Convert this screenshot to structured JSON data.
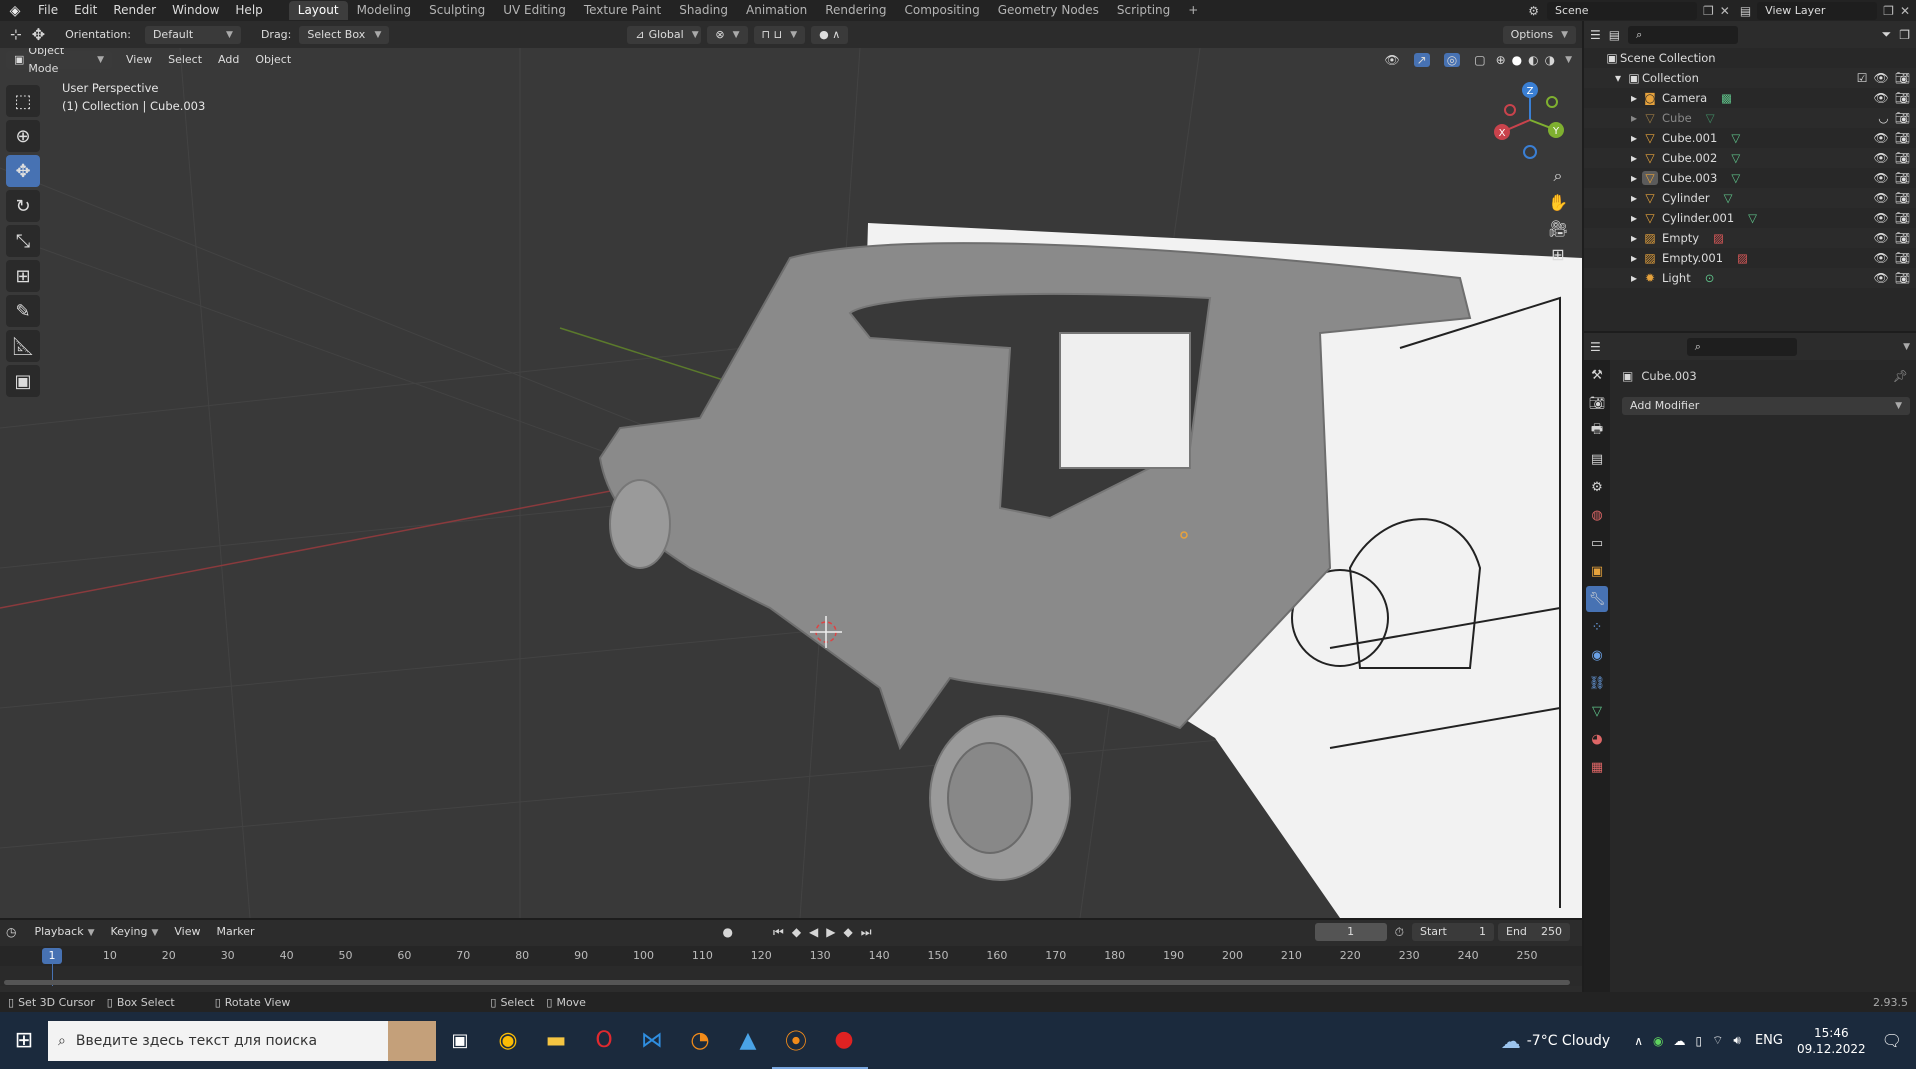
{
  "topbar": {
    "menus": [
      "File",
      "Edit",
      "Render",
      "Window",
      "Help"
    ],
    "workspaces": [
      "Layout",
      "Modeling",
      "Sculpting",
      "UV Editing",
      "Texture Paint",
      "Shading",
      "Animation",
      "Rendering",
      "Compositing",
      "Geometry Nodes",
      "Scripting"
    ],
    "active_workspace": "Layout",
    "add_tab": "+",
    "scene_label": "Scene",
    "view_layer_label": "View Layer"
  },
  "header1": {
    "orientation_label": "Orientation:",
    "orientation_value": "Default",
    "drag_label": "Drag:",
    "drag_value": "Select Box",
    "transform_value": "Global",
    "options_label": "Options"
  },
  "header2": {
    "mode": "Object Mode",
    "menus": [
      "View",
      "Select",
      "Add",
      "Object"
    ]
  },
  "viewport": {
    "perspective": "User Perspective",
    "collection_info": "(1) Collection | Cube.003",
    "gizmo_labels": {
      "x": "X",
      "y": "Y",
      "z": "Z"
    }
  },
  "outliner": {
    "root": "Scene Collection",
    "collection": "Collection",
    "items": [
      {
        "name": "Camera",
        "dim": false
      },
      {
        "name": "Cube",
        "dim": true
      },
      {
        "name": "Cube.001",
        "dim": false
      },
      {
        "name": "Cube.002",
        "dim": false
      },
      {
        "name": "Cube.003",
        "dim": false
      },
      {
        "name": "Cylinder",
        "dim": false
      },
      {
        "name": "Cylinder.001",
        "dim": false
      },
      {
        "name": "Empty",
        "dim": false
      },
      {
        "name": "Empty.001",
        "dim": false
      },
      {
        "name": "Light",
        "dim": false
      }
    ]
  },
  "properties": {
    "object_name": "Cube.003",
    "add_modifier": "Add Modifier"
  },
  "timeline": {
    "menus": [
      "Playback",
      "Keying",
      "View",
      "Marker"
    ],
    "current_frame": "1",
    "start_label": "Start",
    "start_value": "1",
    "end_label": "End",
    "end_value": "250",
    "ticks": [
      "10",
      "20",
      "30",
      "40",
      "50",
      "60",
      "70",
      "80",
      "90",
      "100",
      "110",
      "120",
      "130",
      "140",
      "150",
      "160",
      "170",
      "180",
      "190",
      "200",
      "210",
      "220",
      "230",
      "240",
      "250"
    ],
    "playhead": "1"
  },
  "statusbar": {
    "hint1": "Set 3D Cursor",
    "hint2": "Box Select",
    "hint3": "Rotate View",
    "hint4": "Select",
    "hint5": "Move",
    "version": "2.93.5"
  },
  "taskbar": {
    "search_placeholder": "Введите здесь текст для поиска",
    "weather": "-7°C  Cloudy",
    "lang": "ENG",
    "time": "15:46",
    "date": "09.12.2022"
  },
  "colors": {
    "accent": "#4772b3",
    "x_axis": "#c9434c",
    "y_axis": "#7fb030",
    "z_axis": "#3a7fd4",
    "mesh_icon": "#e6a23c",
    "data_icon": "#5fc38a"
  }
}
